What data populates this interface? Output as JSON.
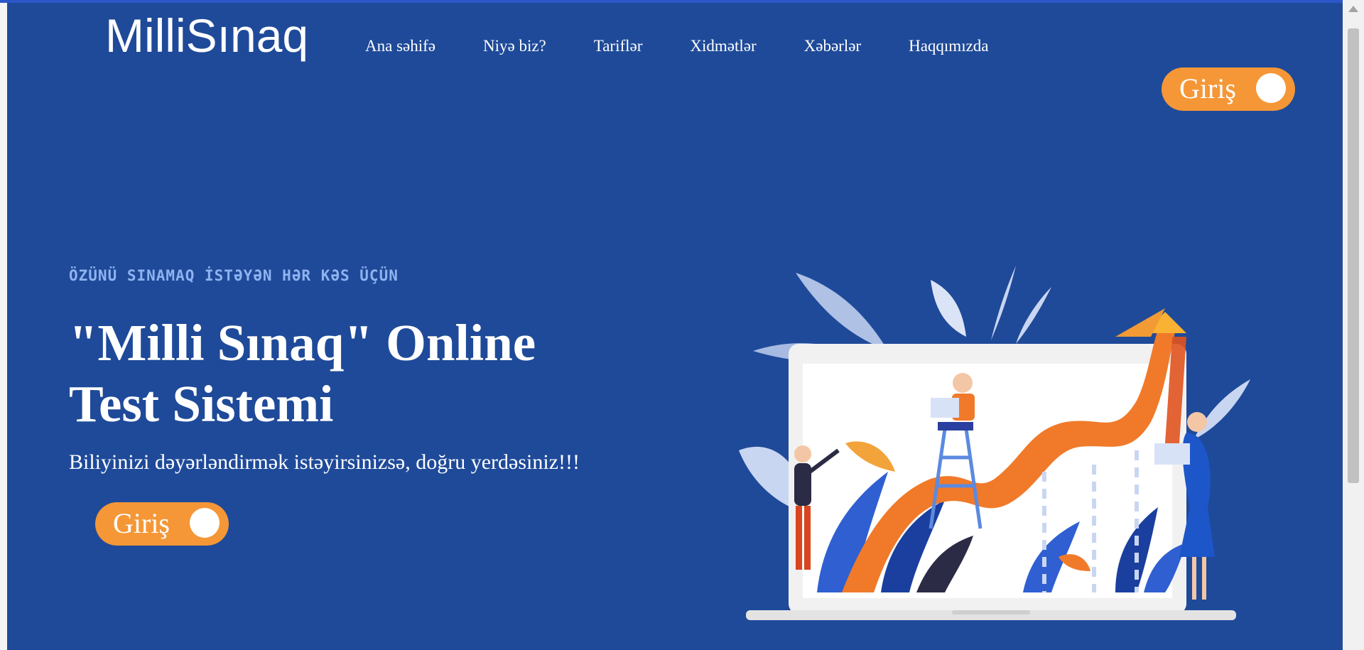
{
  "brand": {
    "logo_text": "MilliSınaq"
  },
  "nav": {
    "items": [
      {
        "label": "Ana səhifə"
      },
      {
        "label": "Niyə biz?"
      },
      {
        "label": "Tariflər"
      },
      {
        "label": "Xidmətlər"
      },
      {
        "label": "Xəbərlər"
      },
      {
        "label": "Haqqımızda"
      }
    ]
  },
  "header": {
    "login_label": "Giriş"
  },
  "hero": {
    "eyebrow": "ÖZÜNÜ SINAMAQ İSTƏYƏN HƏR KƏS ÜÇÜN",
    "title": "\"Milli Sınaq\" Online Test Sistemi",
    "subtitle": "Biliyinizi dəyərləndirmək istəyirsinizsə, doğru yerdəsiniz!!!",
    "login_label": "Giriş"
  },
  "colors": {
    "background": "#1f4a99",
    "accent": "#f59736",
    "eyebrow": "#8fb3f0"
  }
}
